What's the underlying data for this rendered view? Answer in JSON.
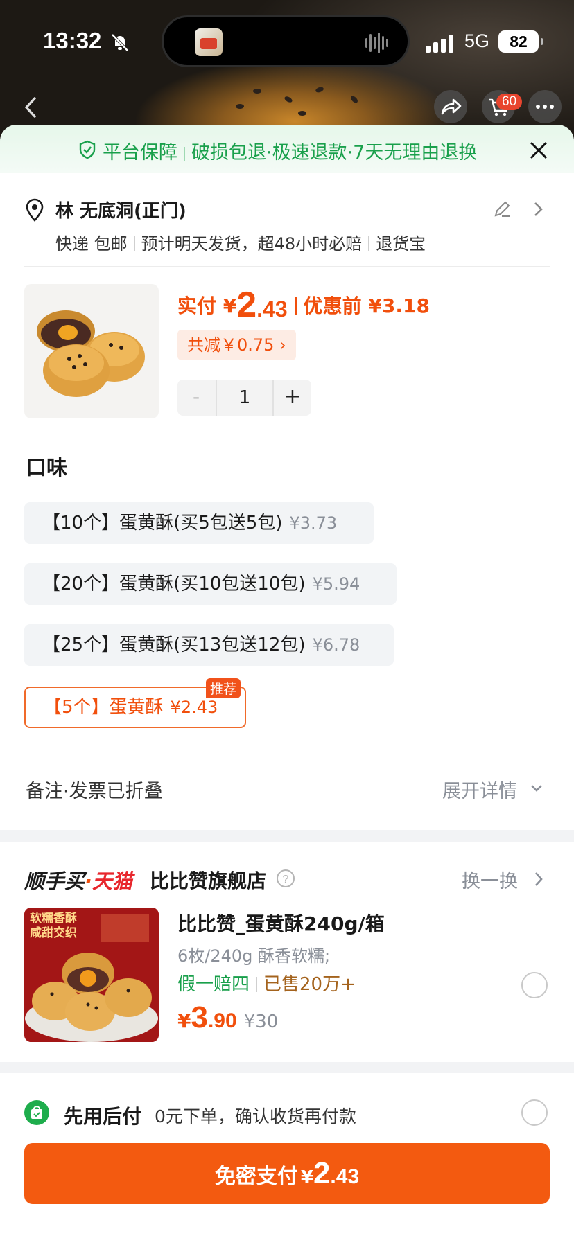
{
  "status_bar": {
    "time": "13:32",
    "network": "5G",
    "battery": "82"
  },
  "nav": {
    "cart_count": "60"
  },
  "guarantee": {
    "label": "平台保障",
    "items": "破损包退·极速退款·7天无理由退换"
  },
  "address": {
    "name": "林  无底洞(正门)",
    "shipping": [
      "快递 包邮",
      "预计明天发货，超48小时必赔",
      "退货宝"
    ]
  },
  "product": {
    "price_label": "实付 ¥",
    "price_int": "2",
    "price_dec": ".43",
    "original_label": "优惠前 ¥3.18",
    "discount": "共减￥0.75 ›",
    "quantity": "1",
    "minus": "-",
    "plus": "+"
  },
  "flavor": {
    "title": "口味",
    "options": [
      {
        "name": "【10个】蛋黄酥(买5包送5包)",
        "price": "¥3.73"
      },
      {
        "name": "【20个】蛋黄酥(买10包送10包)",
        "price": "¥5.94"
      },
      {
        "name": "【25个】蛋黄酥(买13包送12包)",
        "price": "¥6.78"
      },
      {
        "name": "【5个】蛋黄酥",
        "price": "¥2.43",
        "selected": true,
        "badge": "推荐"
      }
    ]
  },
  "notes": {
    "label": "备注·发票已折叠",
    "expand": "展开详情"
  },
  "recommend": {
    "brand": "顺手买",
    "dot": "·",
    "mall": "天猫",
    "store": "比比赞旗舰店",
    "swap": "换一换",
    "image_tag": [
      "软糯香酥",
      "咸甜交织"
    ],
    "title": "比比赞_蛋黄酥240g/箱",
    "desc": "6枚/240g 酥香软糯;",
    "tag1": "假一赔四",
    "tag2": "已售20万+",
    "yen": "¥",
    "price_int": "3",
    "price_dec": ".90",
    "old_price": "¥30"
  },
  "bnpl": {
    "title": "先用后付",
    "desc": "0元下单，确认收货再付款"
  },
  "pay": {
    "label": "免密支付",
    "yen": "¥",
    "int": "2",
    "dec": ".43"
  },
  "colors": {
    "accent": "#f35a10",
    "green": "#19a04b"
  }
}
